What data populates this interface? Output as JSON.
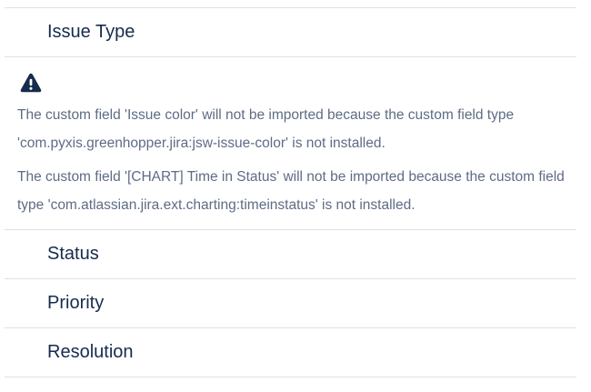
{
  "sections": {
    "issue_type": "Issue Type",
    "status": "Status",
    "priority": "Priority",
    "resolution": "Resolution"
  },
  "warnings": [
    "The custom field 'Issue color' will not be imported because the custom field type 'com.pyxis.greenhopper.jira:jsw-issue-color' is not installed.",
    "The custom field '[CHART] Time in Status' will not be imported because the custom field type 'com.atlassian.jira.ext.charting:timeinstatus' is not installed."
  ],
  "icons": {
    "warning": "warning-triangle-icon"
  },
  "colors": {
    "heading_text": "#172b4d",
    "body_text": "#5e6c84",
    "divider": "#dfe1e6",
    "icon": "#172b4d"
  }
}
